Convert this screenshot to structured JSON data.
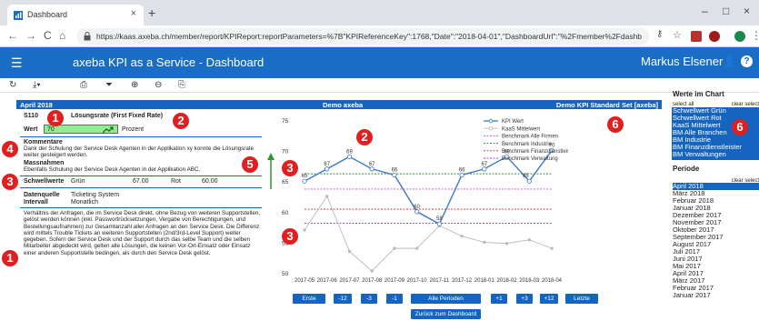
{
  "browser": {
    "tab_title": "Dashboard",
    "tab_close": "×",
    "new_tab": "+",
    "url": "https://kaas.axeba.ch/member/report/KPIReport:reportParameters=%7B\"KPIReferenceKey\":1768,\"Date\":\"2018-04-01\",\"DashboardUrl\":\"%2Fmember%2Fdashboard%3FkpiDomainR...",
    "win_min": "–",
    "win_max": "□",
    "win_close": "×"
  },
  "header": {
    "app_title": "axeba KPI as a Service  -  Dashboard",
    "user": "Markus Elsener",
    "help": "?"
  },
  "report": {
    "period": "April 2018",
    "company": "Demo axeba",
    "kpi_set": "Demo KPI Standard Set [axeba]",
    "kpi_code": "S110",
    "kpi_name": "Lösungsrate (First Fixed Rate)",
    "wert_label": "Wert",
    "wert_value": "70",
    "unit": "Prozent",
    "kommentare_label": "Kommentare",
    "kommentare_text": "Dank der Schulung der Service Desk Agenten in der Applikation xy konnte die Lösungsrate weiter gesteigert werden.",
    "massnahmen_label": "Massnahmen",
    "massnahmen_text": "Ebenfalls Schulung der Service Desk Agenten in der Applikation ABC.",
    "schwellwerte_label": "Schwellwerte",
    "gruen_label": "Grün",
    "gruen_value": "67.00",
    "rot_label": "Rot",
    "rot_value": "60.00",
    "datenquelle_label": "Datenquelle",
    "datenquelle_value": "Ticketing System",
    "intervall_label": "Intervall",
    "intervall_value": "Monatlich",
    "description": "Verhältnis der Anfragen, die im Service Desk direkt, ohne Bezug von weiteren Supportstellen, gelöst werden können (inkl. Passwortrücksetzungen, Vergabe von Berechtigungen, und Bestellungsaufnahmen) zur Gesamtanzahl aller Anfragen an den Service Desk. Die Differenz wird mittels Trouble Tickets an weiteren Supportstellen (2nd/3rd-Level Support) weiter gegeben. Sofern der Service Desk und der Support durch das selbe Team und die selben Mitarbeiter abgedeckt wird, gelten alle Lösungen, die keinen Vor-Ort-Einsatz oder Einsatz einer anderen Supportstelle bedingen, als durch den Service Desk gelöst."
  },
  "right_panel": {
    "werte_title": "Werte im Chart",
    "select_all": "select all",
    "clear_select": "clear select",
    "werte_items": [
      "Schwellwert Grün",
      "Schwellwert Rot",
      "KaaS Mittelwert",
      "BM Alle Branchen",
      "BM Industrie",
      "BM Finanzdienstleister",
      "BM Verwaltungen"
    ],
    "periode_title": "Periode",
    "periode_clear": "clear select",
    "periods": [
      "April 2018",
      "März 2018",
      "Februar 2018",
      "Januar 2018",
      "Dezember 2017",
      "November 2017",
      "Oktober 2017",
      "September 2017",
      "August 2017",
      "Juli 2017",
      "Juni 2017",
      "Mai 2017",
      "April 2017",
      "März 2017",
      "Februar 2017",
      "Januar 2017"
    ]
  },
  "nav_buttons": [
    "Erste",
    "-12",
    "-3",
    "-1",
    "Alle Perioden",
    "+1",
    "+3",
    "+12",
    "Letzte"
  ],
  "back_button": "Zurück zum Dashboard",
  "badges": [
    "1",
    "2",
    "4",
    "3",
    "1",
    "2",
    "3",
    "3",
    "5",
    "6",
    "6"
  ],
  "colors": {
    "accent": "#1565c0",
    "badge": "#e02020",
    "kpi_line": "#3a78c9",
    "green": "#3a9a3a",
    "red": "#c03030"
  },
  "chart_data": {
    "type": "line",
    "categories": [
      "2017-05",
      "2017-06",
      "2017-07",
      "2017-08",
      "2017-09",
      "2017-10",
      "2017-11",
      "2017-12",
      "2018-01",
      "2018-02",
      "2018-03",
      "2018-04"
    ],
    "ylim": [
      50,
      75
    ],
    "yticks": [
      "75",
      "70",
      "65",
      "60",
      "55",
      "50"
    ],
    "series": [
      {
        "name": "KPI Wert",
        "values": [
          65,
          67,
          69,
          67,
          66,
          60,
          58,
          66,
          67,
          69,
          65,
          70
        ],
        "labels": [
          "65",
          "67",
          "69",
          "67",
          "66",
          "60",
          "58",
          "66",
          "67",
          "69",
          "65",
          "70"
        ],
        "color": "#3a78c9"
      },
      {
        "name": "KaaS Mittelwert",
        "values": [
          57,
          62.5,
          53.5,
          50.3,
          54,
          54,
          57.7,
          56,
          55,
          54.8,
          55.4,
          54
        ],
        "color": "#bbbbbb"
      },
      {
        "name": "Benchmark Alle Firmen",
        "values": [
          63.7,
          63.7,
          63.7,
          63.7,
          63.7,
          63.7,
          63.7,
          63.7,
          63.7,
          63.7,
          63.7,
          63.7
        ],
        "color": "#c84fc8"
      },
      {
        "name": "Benchmark Industrie",
        "values": [
          66.2,
          66.2,
          66.2,
          66.2,
          66.2,
          66.2,
          66.2,
          66.2,
          66.2,
          66.2,
          66.2,
          66.2
        ],
        "color": "#2e8b2e"
      },
      {
        "name": "Benchmark Finanzdienstleister",
        "values": [
          60.4,
          60.4,
          60.4,
          60.4,
          60.4,
          60.4,
          60.4,
          60.4,
          60.4,
          60.4,
          60.4,
          60.4
        ],
        "color": "#c02828"
      },
      {
        "name": "Benchmark Verwaltung",
        "values": [
          58.1,
          58.1,
          58.1,
          58.1,
          58.1,
          58.1,
          58.1,
          58.1,
          58.1,
          58.1,
          58.1,
          58.1
        ],
        "color": "#8a3fc8"
      }
    ]
  }
}
